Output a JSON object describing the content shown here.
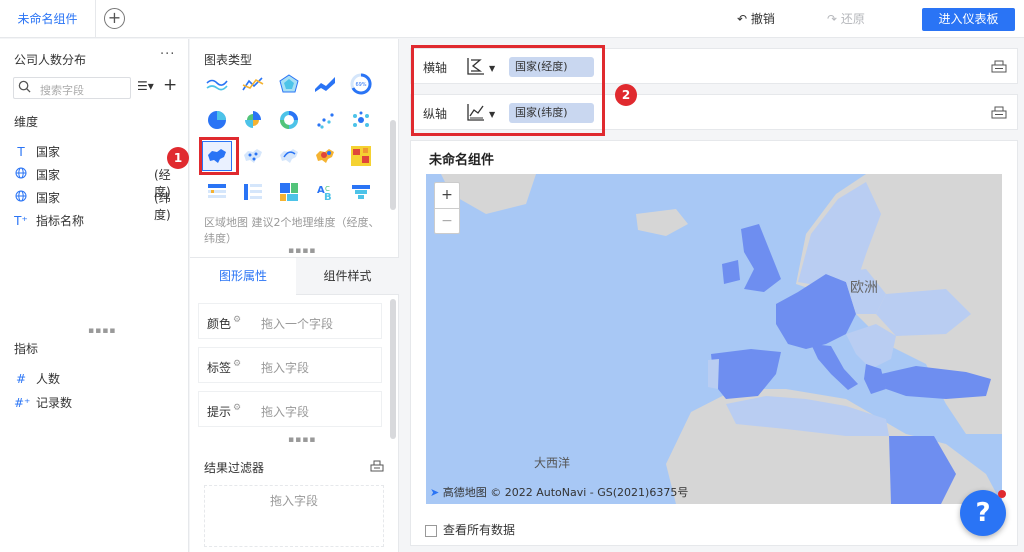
{
  "topbar": {
    "tab_label": "未命名组件",
    "undo_label": "撤销",
    "redo_label": "还原",
    "enter_dashboard_label": "进入仪表板"
  },
  "datasource": {
    "title": "公司人数分布",
    "more_icon": "···",
    "search_placeholder": "搜索字段",
    "dimension_header": "维度",
    "dimensions": [
      {
        "icon": "T",
        "label": "国家",
        "sub": ""
      },
      {
        "icon": "globe-icon",
        "label": "国家",
        "sub": "(经度)"
      },
      {
        "icon": "globe-icon",
        "label": "国家",
        "sub": "(纬度)"
      },
      {
        "icon": "T⁺",
        "label": "指标名称",
        "sub": ""
      }
    ],
    "measure_header": "指标",
    "measures": [
      {
        "icon": "#",
        "label": "人数"
      },
      {
        "icon": "#⁺",
        "label": "记录数"
      }
    ]
  },
  "chart_types": {
    "title": "图表类型",
    "selected": "region-map",
    "description": "区域地图 建议2个地理维度（经度、纬度）",
    "badge1": "1"
  },
  "props": {
    "tab_graph": "图形属性",
    "tab_style": "组件样式",
    "rows": [
      {
        "label": "颜色",
        "placeholder": "拖入一个字段"
      },
      {
        "label": "标签",
        "placeholder": "拖入字段"
      },
      {
        "label": "提示",
        "placeholder": "拖入字段"
      }
    ],
    "filter_title": "结果过滤器",
    "filter_placeholder": "拖入字段"
  },
  "axes": {
    "x_label": "横轴",
    "x_field": "国家(经度)",
    "y_label": "纵轴",
    "y_field": "国家(纬度)",
    "badge2": "2"
  },
  "canvas": {
    "title": "未命名组件",
    "map_label_europe": "欧洲",
    "map_label_atlantic": "大西洋",
    "attribution_brand": "高德地图",
    "attribution": "© 2022 AutoNavi - GS(2021)6375号",
    "zoom_in": "+",
    "zoom_out": "−",
    "show_all": "查看所有数据"
  },
  "help": "?",
  "colors": {
    "accent": "#2a74f5",
    "highlight": "#e02a2f",
    "sea": "#a8c8f5",
    "country_fill": "#6e8ef0",
    "land": "#d6d6d6"
  }
}
